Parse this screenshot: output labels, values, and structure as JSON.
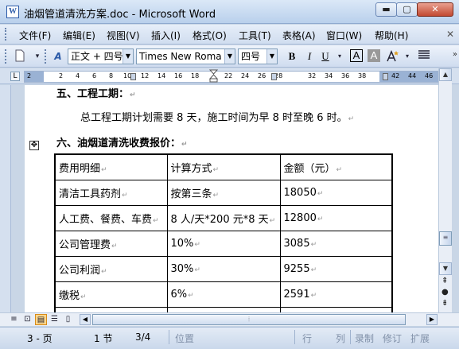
{
  "window": {
    "title": "油烟管道清洗方案.doc - Microsoft Word",
    "min_label": "▬",
    "max_label": "▢",
    "close_label": "✕"
  },
  "menu": {
    "items": [
      "文件(F)",
      "编辑(E)",
      "视图(V)",
      "插入(I)",
      "格式(O)",
      "工具(T)",
      "表格(A)",
      "窗口(W)",
      "帮助(H)"
    ],
    "close_doc": "✕"
  },
  "toolbar": {
    "style_value": "正文 + 四号",
    "font_value": "Times New Roma",
    "size_value": "四号",
    "bold": "B",
    "italic": "I",
    "underline": "U",
    "char_border": "A",
    "char_shading": "A"
  },
  "ruler": {
    "corner": "L",
    "numbers": [
      "2",
      "2",
      "4",
      "6",
      "8",
      "10",
      "12",
      "14",
      "16",
      "18",
      "22",
      "24",
      "26",
      "28",
      "32",
      "34",
      "36",
      "38",
      "42",
      "44",
      "46"
    ]
  },
  "document": {
    "heading5": "五、工程工期：",
    "para": "总工程工期计划需要 8 天，施工时间为早 8 时至晚 6 时。",
    "heading6": "六、油烟道清洗收费报价：",
    "table": {
      "headers": [
        "费用明细",
        "计算方式",
        "金额（元）"
      ],
      "rows": [
        [
          "清洁工具药剂",
          "按第三条",
          "18050"
        ],
        [
          "人工费、餐费、车费",
          "8 人/天*200 元*8 天",
          "12800"
        ],
        [
          "公司管理费",
          "10%",
          "3085"
        ],
        [
          "公司利润",
          "30%",
          "9255"
        ],
        [
          "缴税",
          "6%",
          "2591"
        ]
      ]
    }
  },
  "status": {
    "page": "3 - 页",
    "section": "1 节",
    "page_of": "3/4",
    "position": "位置",
    "line": "行",
    "column": "列",
    "record": "录制",
    "revision": "修订",
    "extend": "扩展"
  }
}
